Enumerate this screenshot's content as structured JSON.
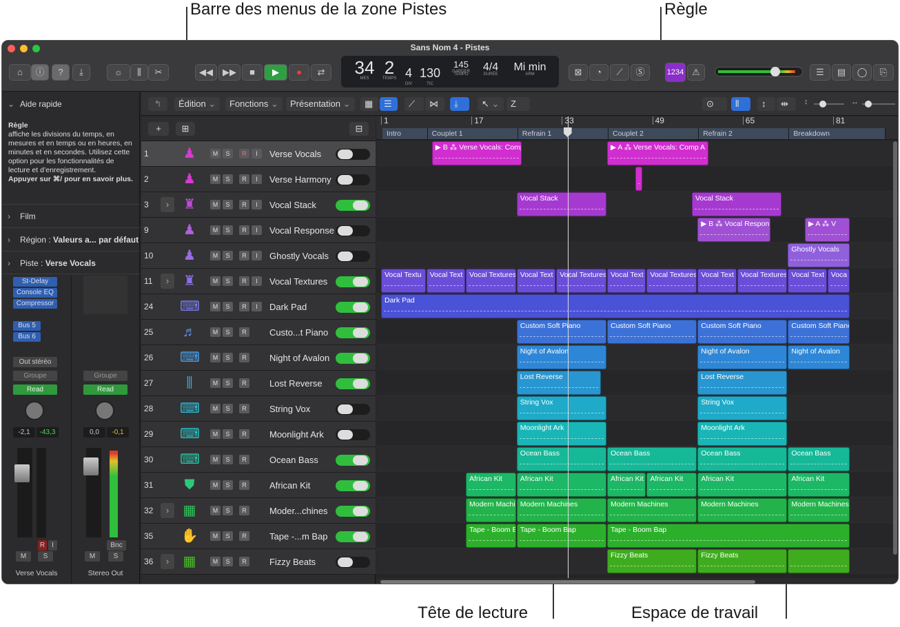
{
  "callouts": {
    "track_menu_bar": "Barre des menus de la zone Pistes",
    "ruler": "Règle",
    "playhead": "Tête de lecture",
    "workspace": "Espace de travail"
  },
  "window": {
    "title": "Sans Nom 4 - Pistes"
  },
  "lcd": {
    "bar": "34",
    "beat": "2",
    "div": "4",
    "tick": "130",
    "tempo": "145",
    "tempo_sub": "GARDER",
    "sig": "4/4",
    "key": "Mi min",
    "lbl_mes": "MES",
    "lbl_temps": "TEMPS",
    "lbl_div": "DIV",
    "lbl_tic": "TIC",
    "lbl_tempo": "TEMPO",
    "lbl_duree": "DURÉE",
    "lbl_arm": "ARM"
  },
  "toolbar": {
    "count_in": "1234"
  },
  "inspector": {
    "quick_help_title": "Aide rapide",
    "quick_help_heading": "Règle",
    "quick_help_body": "affiche les divisions du temps, en mesures et en temps ou en heures, en minutes et en secondes. Utilisez cette option pour les fonctionnalités de lecture et d’enregistrement.",
    "quick_help_more": "Appuyer sur ⌘/ pour en savoir plus.",
    "film": "Film",
    "region_label": "Région :",
    "region_value": "Valeurs a... par défaut",
    "track_label": "Piste :",
    "track_value": "Verse Vocals",
    "plugins": [
      "St-Delay",
      "Console EQ",
      "Compressor"
    ],
    "sends": [
      "Bus 5",
      "Bus 6"
    ],
    "output": "Out stéréo",
    "group": "Groupe",
    "read": "Read",
    "pan_left": "-2,1",
    "pan_left_peak": "-43,3",
    "pan_right": "0,0",
    "pan_right_peak": "-0,1",
    "bnc": "Bnc",
    "strip_left_name": "Verse Vocals",
    "strip_right_name": "Stereo Out",
    "r": "R",
    "i": "I",
    "m": "M",
    "s": "S"
  },
  "track_header": {
    "menus": [
      "Édition",
      "Fonctions",
      "Présentation"
    ],
    "z": "Z"
  },
  "ruler": {
    "bars": [
      "1",
      "17",
      "33",
      "49",
      "65",
      "81"
    ],
    "markers": [
      "Intro",
      "Couplet 1",
      "Refrain 1",
      "Couplet 2",
      "Refrain 2",
      "Breakdown"
    ]
  },
  "tracks": [
    {
      "num": "1",
      "name": "Verse Vocals",
      "icon": "singer",
      "color": "#d63ad0",
      "folder": false,
      "on": false,
      "rec": true
    },
    {
      "num": "2",
      "name": "Verse Harmony",
      "icon": "singer",
      "color": "#d63ad0",
      "folder": false,
      "on": false,
      "rec": true
    },
    {
      "num": "3",
      "name": "Vocal Stack",
      "icon": "choir",
      "color": "#c04ad8",
      "folder": true,
      "on": true,
      "rec": true
    },
    {
      "num": "9",
      "name": "Vocal Response",
      "icon": "singer",
      "color": "#b060d8",
      "folder": false,
      "on": false,
      "rec": true
    },
    {
      "num": "10",
      "name": "Ghostly Vocals",
      "icon": "singer",
      "color": "#9a6cde",
      "folder": false,
      "on": false,
      "rec": true
    },
    {
      "num": "11",
      "name": "Vocal Textures",
      "icon": "choir",
      "color": "#8a6ee6",
      "folder": true,
      "on": true,
      "rec": true
    },
    {
      "num": "24",
      "name": "Dark Pad",
      "icon": "keyboard",
      "color": "#7a7cf0",
      "folder": false,
      "on": true,
      "rec": true
    },
    {
      "num": "25",
      "name": "Custo...t Piano",
      "icon": "piano",
      "color": "#5c90ea",
      "folder": false,
      "on": true,
      "rec": false
    },
    {
      "num": "26",
      "name": "Night of Avalon",
      "icon": "keyboard",
      "color": "#4aa0ea",
      "folder": false,
      "on": true,
      "rec": false
    },
    {
      "num": "27",
      "name": "Lost Reverse",
      "icon": "sampler",
      "color": "#3aace4",
      "folder": false,
      "on": true,
      "rec": false
    },
    {
      "num": "28",
      "name": "String Vox",
      "icon": "keyboard",
      "color": "#30bcd8",
      "folder": false,
      "on": false,
      "rec": false
    },
    {
      "num": "29",
      "name": "Moonlight Ark",
      "icon": "keyboard",
      "color": "#2ac4c8",
      "folder": false,
      "on": false,
      "rec": false
    },
    {
      "num": "30",
      "name": "Ocean Bass",
      "icon": "keyboard",
      "color": "#28c8a8",
      "folder": false,
      "on": true,
      "rec": false
    },
    {
      "num": "31",
      "name": "African Kit",
      "icon": "drum",
      "color": "#2cc878",
      "folder": false,
      "on": true,
      "rec": false
    },
    {
      "num": "32",
      "name": "Moder...chines",
      "icon": "drummachine",
      "color": "#30c458",
      "folder": true,
      "on": true,
      "rec": false
    },
    {
      "num": "35",
      "name": "Tape -...m Bap",
      "icon": "hand",
      "color": "#3cc03a",
      "folder": false,
      "on": true,
      "rec": false
    },
    {
      "num": "36",
      "name": "Fizzy Beats",
      "icon": "drummachine",
      "color": "#48bc28",
      "folder": true,
      "on": false,
      "rec": false
    }
  ],
  "regions": [
    {
      "lane": 0,
      "bar": 10,
      "len": 16,
      "name": "▶ B ⁂ Verse Vocals: Comp B",
      "color": "#d12ed0"
    },
    {
      "lane": 0,
      "bar": 41,
      "len": 18,
      "name": "▶ A ⁂ Verse Vocals: Comp A",
      "color": "#d12ed0"
    },
    {
      "lane": 1,
      "bar": 46,
      "len": 1,
      "name": "",
      "color": "#d12ed0"
    },
    {
      "lane": 2,
      "bar": 25,
      "len": 16,
      "name": "Vocal Stack",
      "color": "#a63ad0"
    },
    {
      "lane": 2,
      "bar": 56,
      "len": 16,
      "name": "Vocal Stack",
      "color": "#a63ad0"
    },
    {
      "lane": 3,
      "bar": 57,
      "len": 13,
      "name": "▶ B ⁂ Vocal Respon",
      "color": "#a050d4"
    },
    {
      "lane": 3,
      "bar": 76,
      "len": 8,
      "name": "▶ A ⁂ V",
      "color": "#a050d4"
    },
    {
      "lane": 4,
      "bar": 73,
      "len": 11,
      "name": "Ghostly Vocals",
      "color": "#9060dc"
    },
    {
      "lane": 5,
      "bar": 1,
      "len": 8,
      "name": "Vocal Textu",
      "color": "#6a4ed8"
    },
    {
      "lane": 5,
      "bar": 9,
      "len": 7,
      "name": "Vocal Text",
      "color": "#6a4ed8"
    },
    {
      "lane": 5,
      "bar": 16,
      "len": 9,
      "name": "Vocal Textures",
      "color": "#6a4ed8"
    },
    {
      "lane": 5,
      "bar": 25,
      "len": 7,
      "name": "Vocal Text",
      "color": "#6a4ed8"
    },
    {
      "lane": 5,
      "bar": 32,
      "len": 9,
      "name": "Vocal Textures",
      "color": "#6a4ed8"
    },
    {
      "lane": 5,
      "bar": 41,
      "len": 7,
      "name": "Vocal Text",
      "color": "#6a4ed8"
    },
    {
      "lane": 5,
      "bar": 48,
      "len": 9,
      "name": "Vocal Textures",
      "color": "#6a4ed8"
    },
    {
      "lane": 5,
      "bar": 57,
      "len": 7,
      "name": "Vocal Text",
      "color": "#6a4ed8"
    },
    {
      "lane": 5,
      "bar": 64,
      "len": 9,
      "name": "Vocal Textures",
      "color": "#6a4ed8"
    },
    {
      "lane": 5,
      "bar": 73,
      "len": 7,
      "name": "Vocal Text",
      "color": "#6a4ed8"
    },
    {
      "lane": 5,
      "bar": 80,
      "len": 4,
      "name": "Voca",
      "color": "#6a4ed8"
    },
    {
      "lane": 6,
      "bar": 1,
      "len": 83,
      "name": "Dark Pad",
      "color": "#4a52d8"
    },
    {
      "lane": 7,
      "bar": 25,
      "len": 16,
      "name": "Custom Soft Piano",
      "color": "#3c72d8"
    },
    {
      "lane": 7,
      "bar": 41,
      "len": 16,
      "name": "Custom Soft Piano",
      "color": "#3c72d8"
    },
    {
      "lane": 7,
      "bar": 57,
      "len": 16,
      "name": "Custom Soft Piano",
      "color": "#3c72d8"
    },
    {
      "lane": 7,
      "bar": 73,
      "len": 11,
      "name": "Custom Soft Piano",
      "color": "#3c72d8"
    },
    {
      "lane": 8,
      "bar": 25,
      "len": 16,
      "name": "Night of Avalon",
      "color": "#2e86d6"
    },
    {
      "lane": 8,
      "bar": 57,
      "len": 16,
      "name": "Night of Avalon",
      "color": "#2e86d6"
    },
    {
      "lane": 8,
      "bar": 73,
      "len": 11,
      "name": "Night of Avalon",
      "color": "#2e86d6"
    },
    {
      "lane": 9,
      "bar": 25,
      "len": 15,
      "name": "Lost Reverse",
      "color": "#2896d0"
    },
    {
      "lane": 9,
      "bar": 57,
      "len": 16,
      "name": "Lost Reverse",
      "color": "#2896d0"
    },
    {
      "lane": 10,
      "bar": 25,
      "len": 16,
      "name": "String Vox",
      "color": "#1eaac8"
    },
    {
      "lane": 10,
      "bar": 57,
      "len": 16,
      "name": "String Vox",
      "color": "#1eaac8"
    },
    {
      "lane": 11,
      "bar": 25,
      "len": 16,
      "name": "Moonlight Ark",
      "color": "#18b6b6"
    },
    {
      "lane": 11,
      "bar": 57,
      "len": 16,
      "name": "Moonlight Ark",
      "color": "#18b6b6"
    },
    {
      "lane": 12,
      "bar": 25,
      "len": 16,
      "name": "Ocean Bass",
      "color": "#16b898"
    },
    {
      "lane": 12,
      "bar": 41,
      "len": 16,
      "name": "Ocean Bass",
      "color": "#16b898"
    },
    {
      "lane": 12,
      "bar": 57,
      "len": 16,
      "name": "Ocean Bass",
      "color": "#16b898"
    },
    {
      "lane": 12,
      "bar": 73,
      "len": 11,
      "name": "Ocean Bass",
      "color": "#16b898"
    },
    {
      "lane": 13,
      "bar": 16,
      "len": 9,
      "name": "African Kit",
      "color": "#1cb866"
    },
    {
      "lane": 13,
      "bar": 25,
      "len": 16,
      "name": "African Kit",
      "color": "#1cb866"
    },
    {
      "lane": 13,
      "bar": 41,
      "len": 7,
      "name": "African Kit",
      "color": "#1cb866"
    },
    {
      "lane": 13,
      "bar": 48,
      "len": 9,
      "name": "African Kit",
      "color": "#1cb866"
    },
    {
      "lane": 13,
      "bar": 57,
      "len": 16,
      "name": "African Kit",
      "color": "#1cb866"
    },
    {
      "lane": 13,
      "bar": 73,
      "len": 11,
      "name": "African Kit",
      "color": "#1cb866"
    },
    {
      "lane": 14,
      "bar": 16,
      "len": 9,
      "name": "Modern Machin",
      "color": "#22b44a"
    },
    {
      "lane": 14,
      "bar": 25,
      "len": 16,
      "name": "Modern Machines",
      "color": "#22b44a"
    },
    {
      "lane": 14,
      "bar": 41,
      "len": 16,
      "name": "Modern Machines",
      "color": "#22b44a"
    },
    {
      "lane": 14,
      "bar": 57,
      "len": 16,
      "name": "Modern Machines",
      "color": "#22b44a"
    },
    {
      "lane": 14,
      "bar": 73,
      "len": 11,
      "name": "Modern Machines",
      "color": "#22b44a"
    },
    {
      "lane": 15,
      "bar": 16,
      "len": 9,
      "name": "Tape - Boom B",
      "color": "#2cb02c"
    },
    {
      "lane": 15,
      "bar": 25,
      "len": 16,
      "name": "Tape - Boom Bap",
      "color": "#2cb02c"
    },
    {
      "lane": 15,
      "bar": 41,
      "len": 43,
      "name": "Tape - Boom Bap",
      "color": "#2cb02c"
    },
    {
      "lane": 16,
      "bar": 41,
      "len": 16,
      "name": "Fizzy Beats",
      "color": "#3eac1e"
    },
    {
      "lane": 16,
      "bar": 57,
      "len": 16,
      "name": "Fizzy Beats",
      "color": "#3eac1e"
    },
    {
      "lane": 16,
      "bar": 73,
      "len": 11,
      "name": "",
      "color": "#3eac1e"
    }
  ],
  "playhead_bar": 34
}
